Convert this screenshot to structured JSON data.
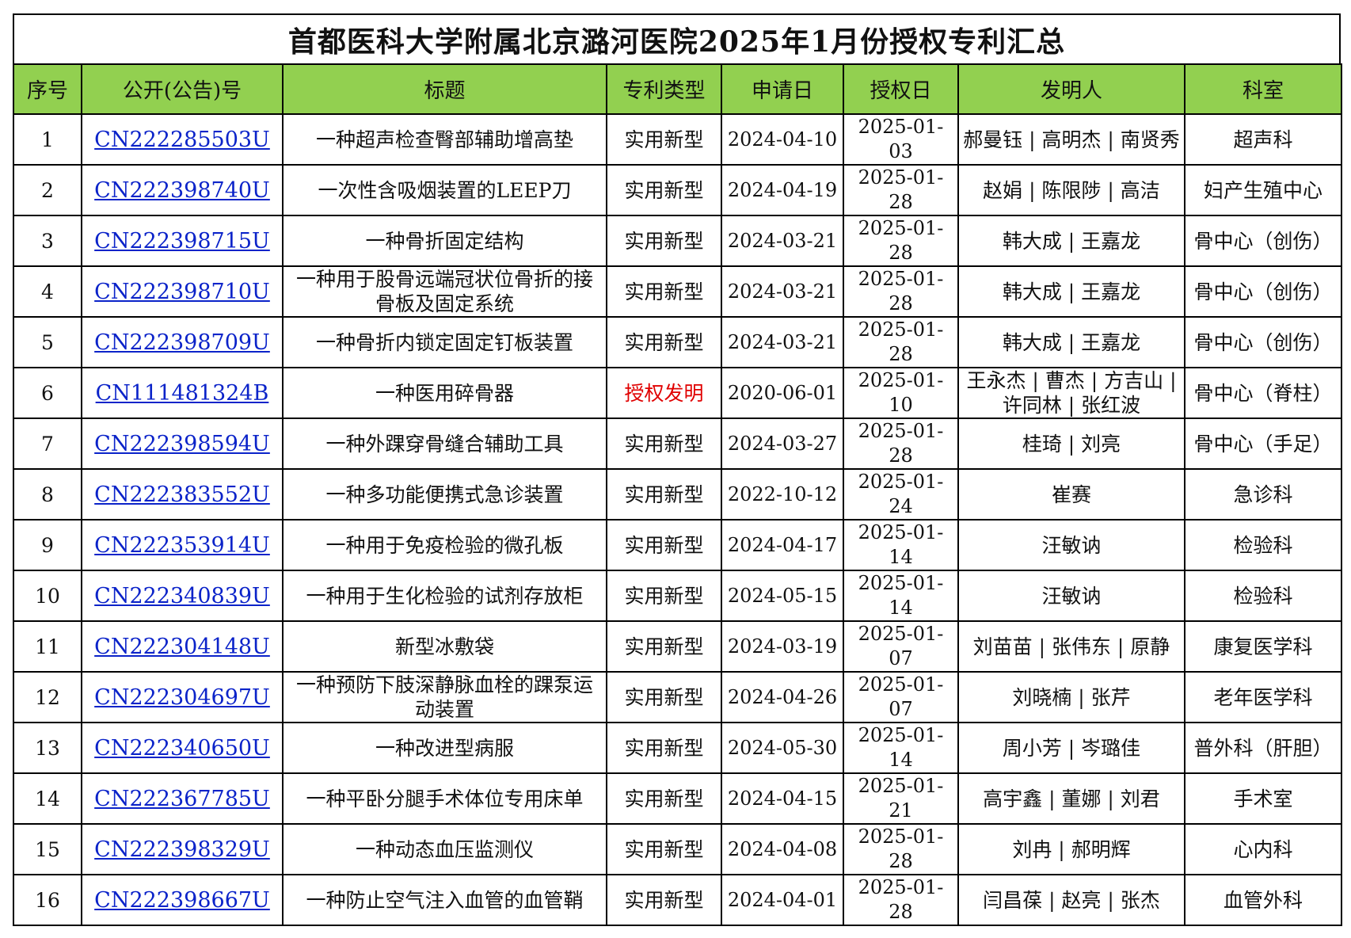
{
  "title": "首都医科大学附属北京潞河医院2025年1月份授权专利汇总",
  "colors": {
    "header_bg": "#92d050",
    "link": "#0b23c9",
    "invention_type": "#e00000"
  },
  "columns": [
    "序号",
    "公开(公告)号",
    "标题",
    "专利类型",
    "申请日",
    "授权日",
    "发明人",
    "科室"
  ],
  "rows": [
    {
      "no": "1",
      "pub": "CN222285503U",
      "title": "一种超声检查臀部辅助增高垫",
      "type": "实用新型",
      "apply": "2024-04-10",
      "grant": "2025-01-03",
      "inventors": "郝曼钰 | 高明杰 | 南贤秀",
      "dept": "超声科"
    },
    {
      "no": "2",
      "pub": "CN222398740U",
      "title": "一次性含吸烟装置的LEEP刀",
      "type": "实用新型",
      "apply": "2024-04-19",
      "grant": "2025-01-28",
      "inventors": "赵娟 | 陈限陟 | 高洁",
      "dept": "妇产生殖中心"
    },
    {
      "no": "3",
      "pub": "CN222398715U",
      "title": "一种骨折固定结构",
      "type": "实用新型",
      "apply": "2024-03-21",
      "grant": "2025-01-28",
      "inventors": "韩大成 | 王嘉龙",
      "dept": "骨中心（创伤）"
    },
    {
      "no": "4",
      "pub": "CN222398710U",
      "title": "一种用于股骨远端冠状位骨折的接骨板及固定系统",
      "type": "实用新型",
      "apply": "2024-03-21",
      "grant": "2025-01-28",
      "inventors": "韩大成 | 王嘉龙",
      "dept": "骨中心（创伤）"
    },
    {
      "no": "5",
      "pub": "CN222398709U",
      "title": "一种骨折内锁定固定钉板装置",
      "type": "实用新型",
      "apply": "2024-03-21",
      "grant": "2025-01-28",
      "inventors": "韩大成 | 王嘉龙",
      "dept": "骨中心（创伤）"
    },
    {
      "no": "6",
      "pub": "CN111481324B",
      "title": "一种医用碎骨器",
      "type": "授权发明",
      "apply": "2020-06-01",
      "grant": "2025-01-10",
      "inventors": "王永杰 | 曹杰 | 方吉山 | 许同林 | 张红波",
      "dept": "骨中心（脊柱）"
    },
    {
      "no": "7",
      "pub": "CN222398594U",
      "title": "一种外踝穿骨缝合辅助工具",
      "type": "实用新型",
      "apply": "2024-03-27",
      "grant": "2025-01-28",
      "inventors": "桂琦 | 刘亮",
      "dept": "骨中心（手足）"
    },
    {
      "no": "8",
      "pub": "CN222383552U",
      "title": "一种多功能便携式急诊装置",
      "type": "实用新型",
      "apply": "2022-10-12",
      "grant": "2025-01-24",
      "inventors": "崔赛",
      "dept": "急诊科"
    },
    {
      "no": "9",
      "pub": "CN222353914U",
      "title": "一种用于免疫检验的微孔板",
      "type": "实用新型",
      "apply": "2024-04-17",
      "grant": "2025-01-14",
      "inventors": "汪敏讷",
      "dept": "检验科"
    },
    {
      "no": "10",
      "pub": "CN222340839U",
      "title": "一种用于生化检验的试剂存放柜",
      "type": "实用新型",
      "apply": "2024-05-15",
      "grant": "2025-01-14",
      "inventors": "汪敏讷",
      "dept": "检验科"
    },
    {
      "no": "11",
      "pub": "CN222304148U",
      "title": "新型冰敷袋",
      "type": "实用新型",
      "apply": "2024-03-19",
      "grant": "2025-01-07",
      "inventors": "刘苗苗 | 张伟东 | 原静",
      "dept": "康复医学科"
    },
    {
      "no": "12",
      "pub": "CN222304697U",
      "title": "一种预防下肢深静脉血栓的踝泵运动装置",
      "type": "实用新型",
      "apply": "2024-04-26",
      "grant": "2025-01-07",
      "inventors": "刘晓楠 | 张芹",
      "dept": "老年医学科"
    },
    {
      "no": "13",
      "pub": "CN222340650U",
      "title": "一种改进型病服",
      "type": "实用新型",
      "apply": "2024-05-30",
      "grant": "2025-01-14",
      "inventors": "周小芳 | 岑璐佳",
      "dept": "普外科（肝胆）"
    },
    {
      "no": "14",
      "pub": "CN222367785U",
      "title": "一种平卧分腿手术体位专用床单",
      "type": "实用新型",
      "apply": "2024-04-15",
      "grant": "2025-01-21",
      "inventors": "高宇鑫 | 董娜 | 刘君",
      "dept": "手术室"
    },
    {
      "no": "15",
      "pub": "CN222398329U",
      "title": "一种动态血压监测仪",
      "type": "实用新型",
      "apply": "2024-04-08",
      "grant": "2025-01-28",
      "inventors": "刘冉 | 郝明辉",
      "dept": "心内科"
    },
    {
      "no": "16",
      "pub": "CN222398667U",
      "title": "一种防止空气注入血管的血管鞘",
      "type": "实用新型",
      "apply": "2024-04-01",
      "grant": "2025-01-28",
      "inventors": "闫昌葆 | 赵亮 | 张杰",
      "dept": "血管外科"
    }
  ]
}
